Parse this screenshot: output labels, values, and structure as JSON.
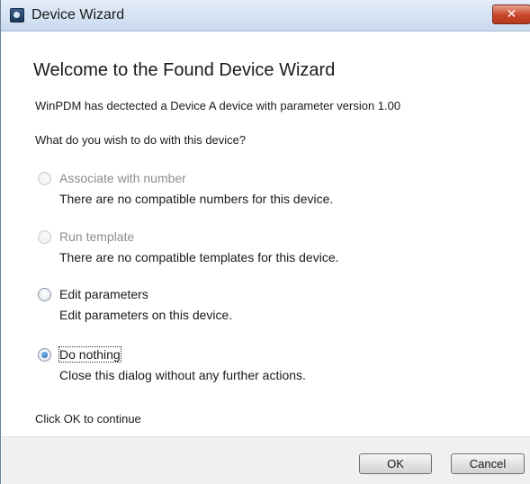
{
  "window": {
    "title": "Device Wizard",
    "close_glyph": "✕",
    "icon": "device-wizard-app-icon"
  },
  "main": {
    "heading": "Welcome to the Found Device Wizard",
    "detected_text": "WinPDM has dectected a Device A device with parameter version 1.00",
    "question": "What do you wish to do with this device?",
    "options": [
      {
        "label": "Associate with number",
        "description": "There are no compatible numbers for this device.",
        "enabled": false,
        "selected": false
      },
      {
        "label": "Run template",
        "description": "There are no compatible templates for this device.",
        "enabled": false,
        "selected": false
      },
      {
        "label": "Edit parameters",
        "description": "Edit parameters on this device.",
        "enabled": true,
        "selected": false
      },
      {
        "label": "Do nothing",
        "description": "Close this dialog without any further actions.",
        "enabled": true,
        "selected": true
      }
    ],
    "continue_text": "Click OK to continue"
  },
  "footer": {
    "ok_label": "OK",
    "cancel_label": "Cancel"
  },
  "colors": {
    "titlebar": "#c9d9ee",
    "close_button": "#c7462a",
    "disabled_text": "#8d8d8d",
    "footer_bg": "#f0f0f0"
  }
}
